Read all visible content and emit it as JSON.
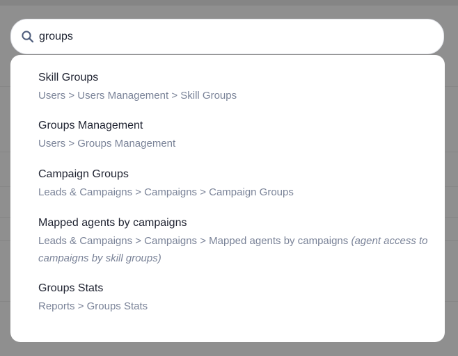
{
  "search": {
    "value": "groups",
    "icon": "search-icon"
  },
  "results": [
    {
      "title": "Skill Groups",
      "path": "Users > Users Management > Skill Groups",
      "note": ""
    },
    {
      "title": "Groups Management",
      "path": "Users > Groups Management",
      "note": ""
    },
    {
      "title": "Campaign Groups",
      "path": "Leads & Campaigns > Campaigns > Campaign Groups",
      "note": ""
    },
    {
      "title": "Mapped agents by campaigns",
      "path": "Leads & Campaigns > Campaigns > Mapped agents by campaigns",
      "note": "(agent access to campaigns by skill groups)"
    },
    {
      "title": "Groups Stats",
      "path": "Reports > Groups Stats",
      "note": ""
    }
  ],
  "colors": {
    "overlay": "#8f8f8f",
    "title_text": "#1e2230",
    "path_text": "#7a8398",
    "accent_icon": "#4b5a7a"
  }
}
